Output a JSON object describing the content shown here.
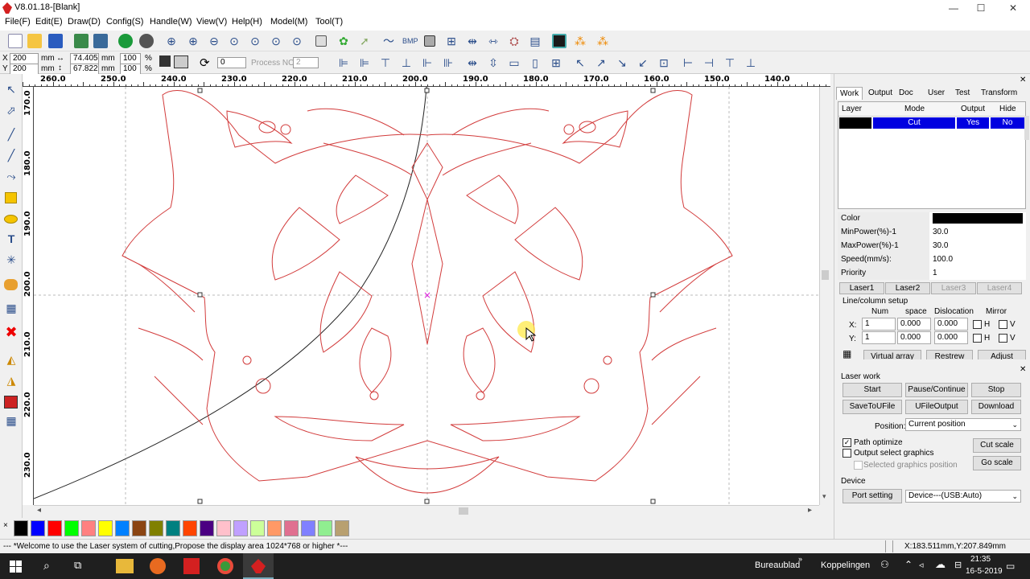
{
  "window": {
    "title": "V8.01.18-[Blank]",
    "min_glyph": "—",
    "max_glyph": "☐",
    "close_glyph": "✕"
  },
  "menu": [
    "File(F)",
    "Edit(E)",
    "Draw(D)",
    "Config(S)",
    "Handle(W)",
    "View(V)",
    "Help(H)",
    "Model(M)",
    "Tool(T)"
  ],
  "toolbar2": {
    "x_label": "X",
    "y_label": "Y",
    "x_value": "200",
    "y_value": "200",
    "mm1": "mm",
    "mm2": "mm",
    "w_value": "74.405",
    "h_value": "67.822",
    "mm3": "mm",
    "mm4": "mm",
    "scale_w": "100",
    "scale_h": "100",
    "pct1": "%",
    "pct2": "%",
    "rotate_value": "0",
    "process_label": "Process NO:",
    "process_value": "2"
  },
  "hruler_labels": [
    "260.0",
    "250.0",
    "240.0",
    "230.0",
    "220.0",
    "210.0",
    "200.0",
    "190.0",
    "180.0",
    "170.0",
    "160.0",
    "150.0",
    "140.0"
  ],
  "vruler_labels": [
    "170.0",
    "180.0",
    "190.0",
    "200.0",
    "210.0",
    "220.0",
    "230.0"
  ],
  "palette_colors": [
    "#000000",
    "#0000ff",
    "#ff0000",
    "#00ff00",
    "#ff8080",
    "#ffff00",
    "#0080ff",
    "#8b4513",
    "#808000",
    "#008080",
    "#ff4500",
    "#4b0082",
    "#ffc0cb",
    "#c0a0ff",
    "#ccff99",
    "#ff9966",
    "#e07090",
    "#8080ff",
    "#90ee90",
    "#b8a070"
  ],
  "status_text": "--- *Welcome to use the Laser system of cutting,Propose the display area 1024*768 or higher *---",
  "coord_text": "X:183.511mm,Y:207.849mm",
  "panel": {
    "tabs": [
      "Work",
      "Output",
      "Doc",
      "User",
      "Test",
      "Transform"
    ],
    "layer_headers": [
      "Layer",
      "Mode",
      "Output",
      "Hide"
    ],
    "layer_row": {
      "mode": "Cut",
      "output": "Yes",
      "hide": "No"
    },
    "props": [
      {
        "label": "Color",
        "value": ""
      },
      {
        "label": "MinPower(%)-1",
        "value": "30.0"
      },
      {
        "label": "MaxPower(%)-1",
        "value": "30.0"
      },
      {
        "label": "Speed(mm/s):",
        "value": "100.0"
      },
      {
        "label": "Priority",
        "value": "1"
      }
    ],
    "laser_tabs": [
      "Laser1",
      "Laser2",
      "Laser3",
      "Laser4"
    ],
    "linecol_label": "Line/column setup",
    "array_headers": [
      "Num",
      "space",
      "Dislocation",
      "Mirror"
    ],
    "array_x": {
      "label": "X:",
      "num": "1",
      "space": "0.000",
      "dislocation": "0.000",
      "h": "H",
      "v": "V"
    },
    "array_y": {
      "label": "Y:",
      "num": "1",
      "space": "0.000",
      "dislocation": "0.000",
      "h": "H",
      "v": "V"
    },
    "array_buttons": [
      "Virtual array",
      "Restrew",
      "Adjust"
    ],
    "laserwork_label": "Laser work",
    "btn_start": "Start",
    "btn_pause": "Pause/Continue",
    "btn_stop": "Stop",
    "btn_savefile": "SaveToUFile",
    "btn_ufile": "UFileOutput",
    "btn_download": "Download",
    "position_label": "Position:",
    "position_value": "Current position",
    "path_optimize": "Path optimize",
    "output_select": "Output select graphics",
    "selected_pos": "Selected graphics position",
    "btn_cutscale": "Cut scale",
    "btn_goscale": "Go scale",
    "device_label": "Device",
    "btn_port": "Port setting",
    "device_value": "Device---(USB:Auto)"
  },
  "taskbar": {
    "bureaublad": "Bureaublad",
    "koppelingen": "Koppelingen",
    "time": "21:35",
    "date": "16-5-2019"
  }
}
